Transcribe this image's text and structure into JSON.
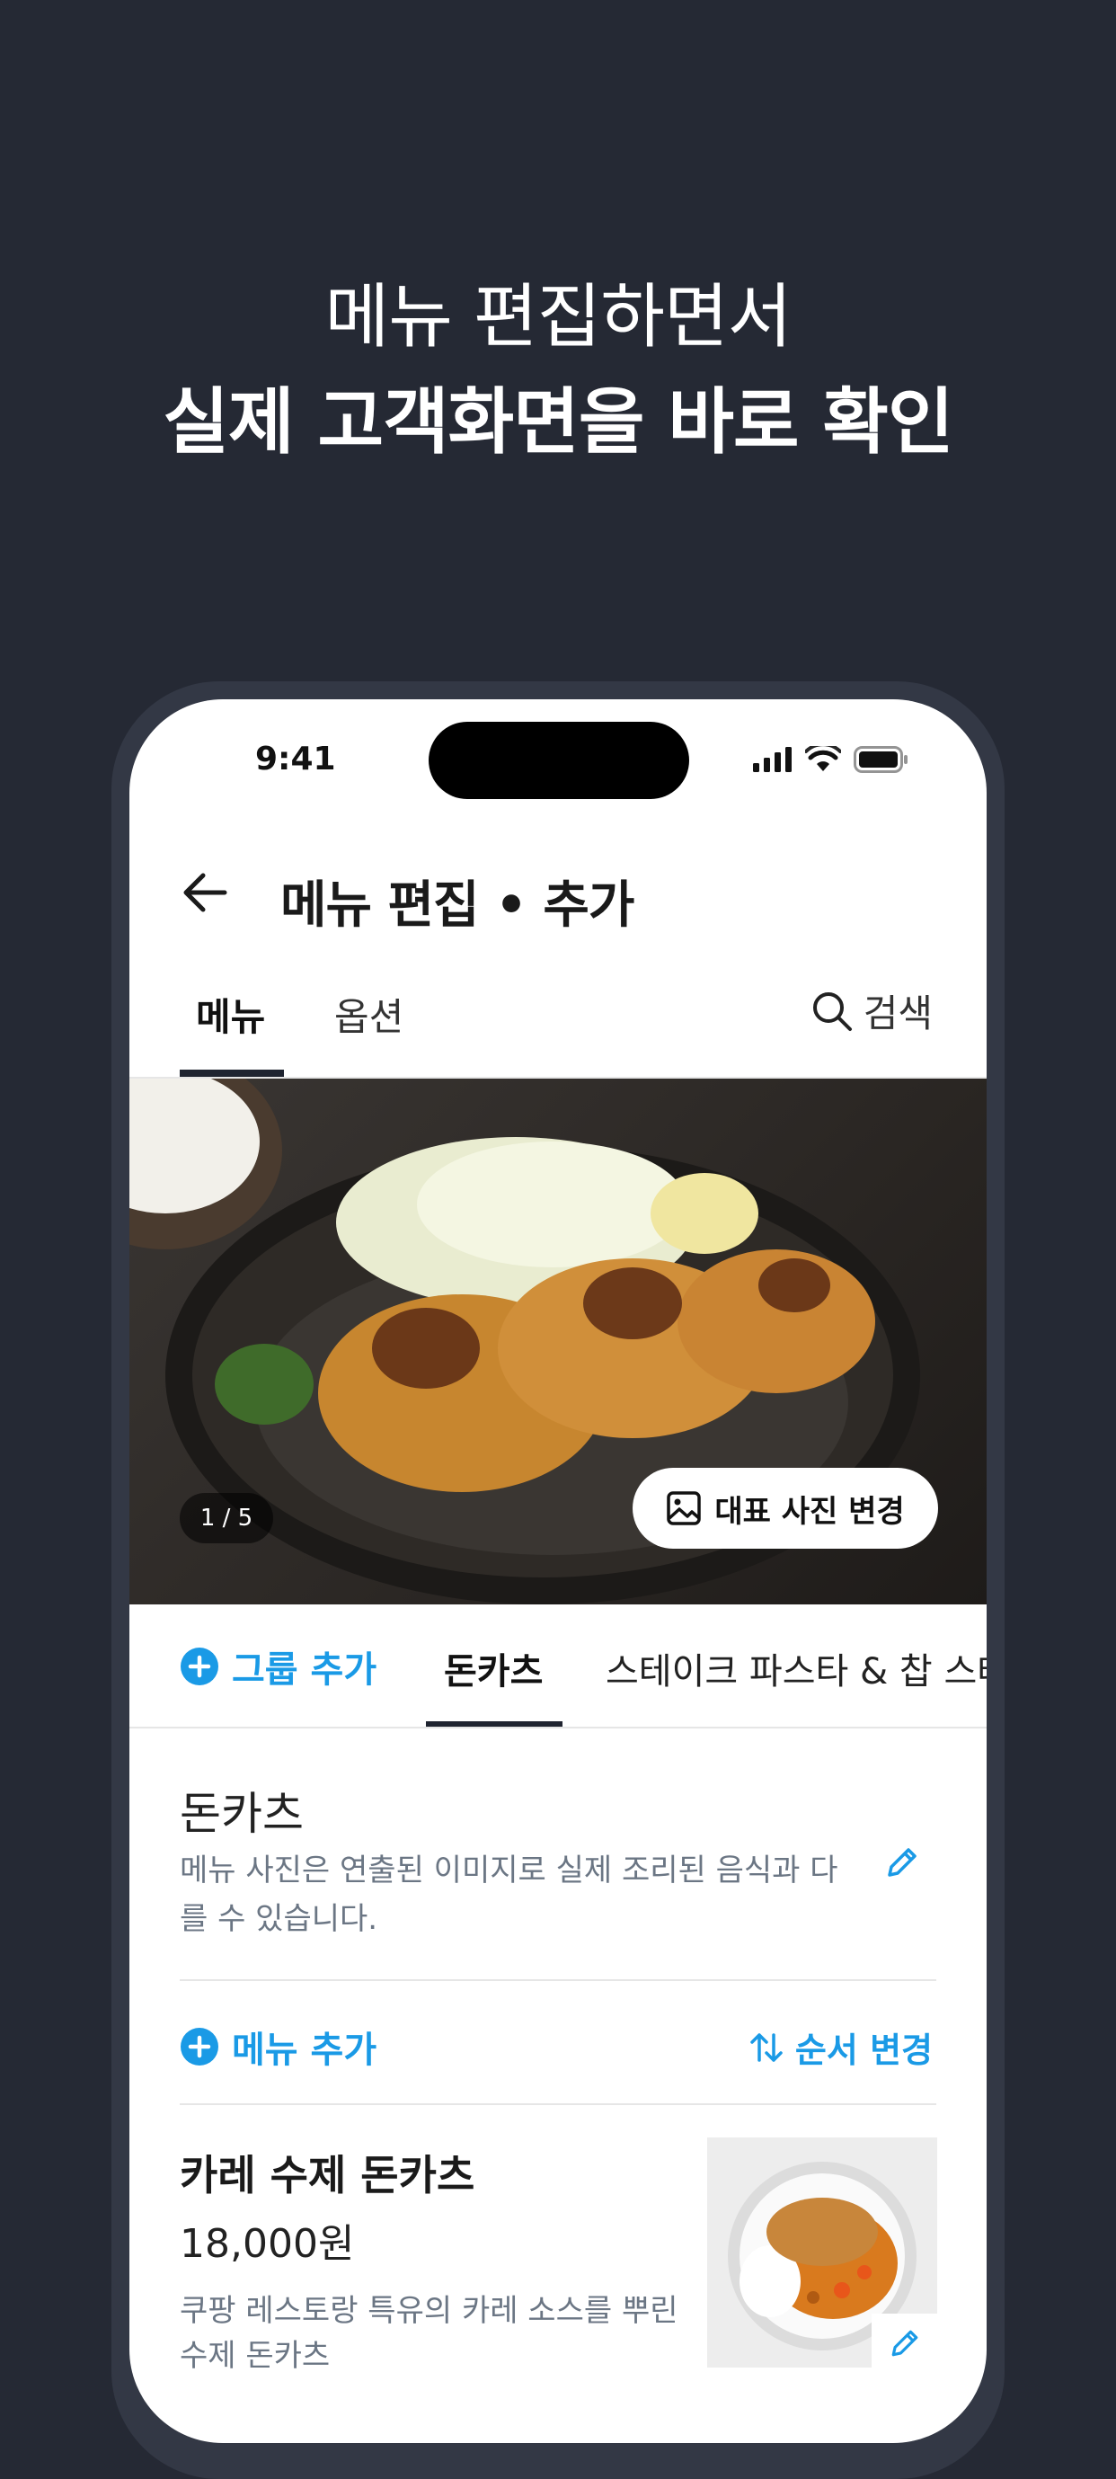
{
  "headline": {
    "line1": "메뉴 편집하면서",
    "line2": "실제 고객화면을 바로 확인"
  },
  "status_bar": {
    "time": "9:41"
  },
  "nav": {
    "title": "메뉴 편집 • 추가",
    "back_icon": "arrow-left-icon"
  },
  "tabs": {
    "menu": "메뉴",
    "option": "옵션",
    "search": "검색"
  },
  "hero": {
    "counter": "1 / 5",
    "change_photo": "대표 사진 변경"
  },
  "groups": {
    "add_group": "그룹 추가",
    "items": [
      "돈카츠",
      "스테이크 파스타 & 찹 스테이크"
    ]
  },
  "section": {
    "title": "돈카츠",
    "description": "메뉴 사진은 연출된 이미지로 실제 조리된 음식과 다를 수 있습니다."
  },
  "actions": {
    "add_menu": "메뉴 추가",
    "reorder": "순서 변경"
  },
  "menu_item": {
    "name": "카레 수제 돈카츠",
    "price": "18,000원",
    "description": "쿠팡 레스토랑 특유의 카레 소스를 뿌린 수제 돈카츠"
  },
  "colors": {
    "background": "#252934",
    "accent": "#1a9ae6",
    "text_secondary": "#6b7684"
  }
}
